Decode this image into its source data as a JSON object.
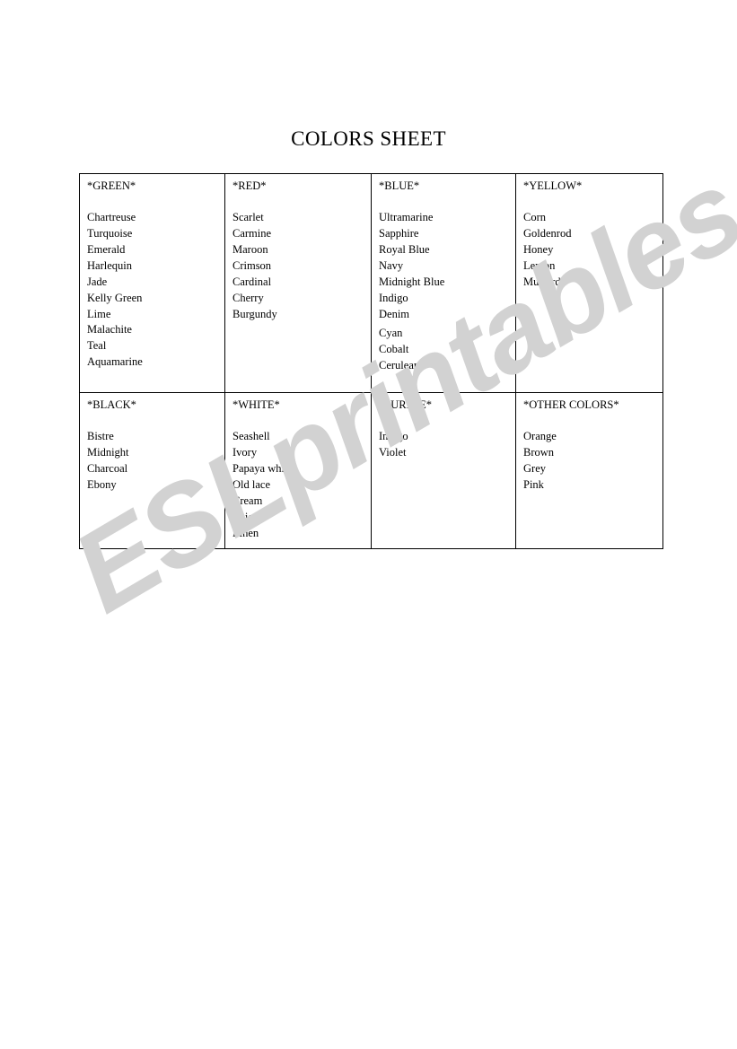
{
  "document": {
    "title": "COLORS SHEET",
    "watermark": "ESLprintables.com",
    "watermark_color": "#d2d2d2",
    "text_color": "#000000",
    "border_color": "#000000",
    "background": "#ffffff"
  },
  "table": {
    "rows": [
      {
        "cells": [
          {
            "header": "*GREEN*",
            "items": [
              "Chartreuse",
              "Turquoise",
              "Emerald",
              "Harlequin",
              "Jade",
              "Kelly Green",
              "Lime",
              "Malachite",
              "Teal",
              "Aquamarine"
            ],
            "gap_before_index": null
          },
          {
            "header": "*RED*",
            "items": [
              "Scarlet",
              "Carmine",
              "Maroon",
              "Crimson",
              "Cardinal",
              "Cherry",
              "Burgundy"
            ],
            "gap_before_index": null
          },
          {
            "header": "*BLUE*",
            "items": [
              "Ultramarine",
              "Sapphire",
              "Royal Blue",
              "Navy",
              "Midnight Blue",
              "Indigo",
              "Denim",
              "Cyan",
              "Cobalt",
              "Cerulean"
            ],
            "gap_before_index": 7
          },
          {
            "header": "*YELLOW*",
            "items": [
              "Corn",
              "Goldenrod",
              "Honey",
              "Lemon",
              "Mustard"
            ],
            "gap_before_index": null
          }
        ]
      },
      {
        "cells": [
          {
            "header": "*BLACK*",
            "items": [
              "Bistre",
              "Midnight",
              "Charcoal",
              "Ebony"
            ],
            "gap_before_index": null
          },
          {
            "header": "*WHITE*",
            "items": [
              "Seashell",
              "Ivory",
              "Papaya whip",
              "Old lace",
              "Cream",
              "Beige",
              "Linen"
            ],
            "gap_before_index": null
          },
          {
            "header": "*PURPLE*",
            "items": [
              "Indigo",
              "Violet"
            ],
            "gap_before_index": null
          },
          {
            "header": "*OTHER COLORS*",
            "items": [
              "Orange",
              "Brown",
              "Grey",
              "Pink"
            ],
            "gap_before_index": null
          }
        ]
      }
    ]
  }
}
